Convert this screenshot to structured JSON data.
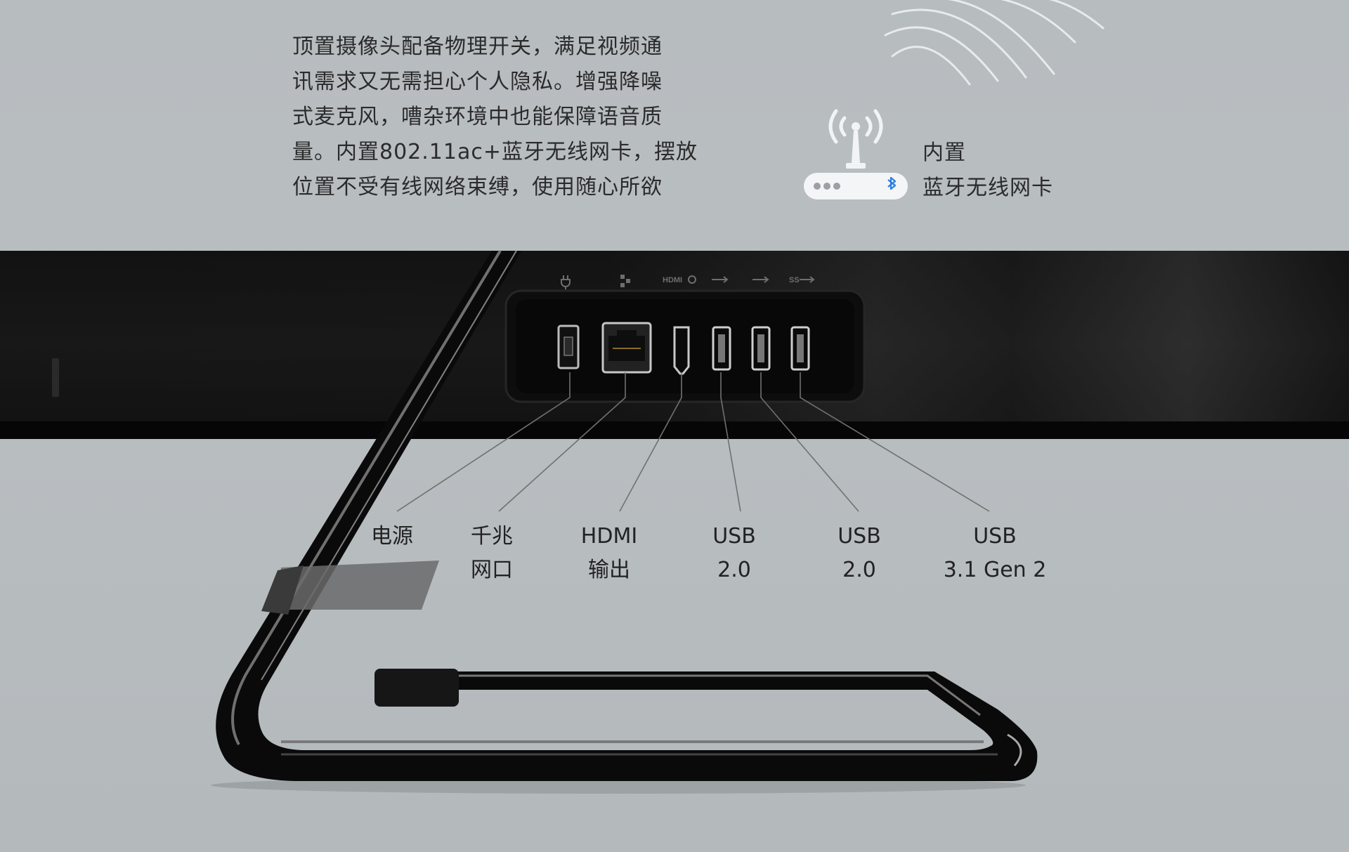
{
  "description": {
    "lines": [
      "顶置摄像头配备物理开关，满足视频通",
      "讯需求又无需担心个人隐私。增强降噪",
      "式麦克风，嘈杂环境中也能保障语音质",
      "量。内置802.11ac+蓝牙无线网卡，摆放",
      "位置不受有线网络束缚，使用随心所欲"
    ]
  },
  "wireless": {
    "line1": "内置",
    "line2": "蓝牙无线网卡"
  },
  "ports": [
    {
      "name": "power",
      "line1": "电源",
      "line2": ""
    },
    {
      "name": "ethernet",
      "line1": "千兆",
      "line2": "网口"
    },
    {
      "name": "hdmi",
      "line1": "HDMI",
      "line2": "输出"
    },
    {
      "name": "usb-2-a",
      "line1": "USB",
      "line2": "2.0"
    },
    {
      "name": "usb-2-b",
      "line1": "USB",
      "line2": "2.0"
    },
    {
      "name": "usb-31",
      "line1": "USB",
      "line2": "3.1 Gen 2"
    }
  ],
  "port_icons": [
    "power-icon",
    "ethernet-icon",
    "hdmi-icon",
    "usb-icon",
    "usb-icon",
    "usb-ss-icon"
  ],
  "port_icon_text": {
    "hdmi": "HDMI",
    "ss": "SS"
  },
  "colors": {
    "background": "#b8bdc0",
    "monitor_body": "#121212",
    "text": "#2b2b2b",
    "bluetooth": "#2a7de1"
  }
}
